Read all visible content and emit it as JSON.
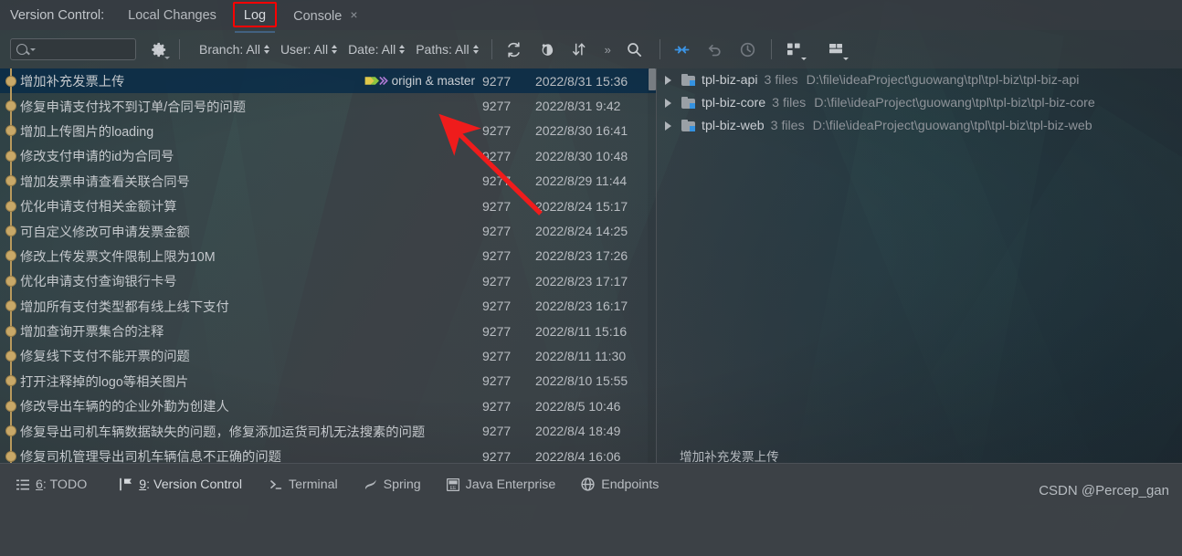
{
  "window": {
    "tool_window_label": "Version Control:",
    "tabs": [
      {
        "label": "Local Changes",
        "selected": false,
        "closable": false
      },
      {
        "label": "Log",
        "selected": true,
        "closable": false
      },
      {
        "label": "Console",
        "selected": false,
        "closable": true,
        "close_glyph": "×"
      }
    ]
  },
  "toolbar": {
    "search_placeholder": "",
    "search_value": "",
    "search_icon": "search-icon",
    "settings_icon": "gear-icon",
    "filters": [
      {
        "name": "branch",
        "label": "Branch: All"
      },
      {
        "name": "user",
        "label": "User: All"
      },
      {
        "name": "date",
        "label": "Date: All"
      },
      {
        "name": "paths",
        "label": "Paths: All"
      }
    ],
    "actions": [
      {
        "name": "refresh-icon",
        "glyph": "↻",
        "enabled": true
      },
      {
        "name": "highlight-icon",
        "glyph": "◕",
        "enabled": true
      },
      {
        "name": "sort-icon",
        "glyph": "⇅",
        "enabled": true
      },
      {
        "name": "overflow-chevrons",
        "glyph": "»",
        "enabled": true
      },
      {
        "name": "search-icon",
        "glyph": "⚲",
        "enabled": true
      }
    ],
    "right_actions": [
      {
        "name": "collapse-icon",
        "glyph": "→←",
        "enabled": true,
        "color": "#3592e0"
      },
      {
        "name": "revert-icon",
        "glyph": "↶",
        "enabled": false
      },
      {
        "name": "history-icon",
        "glyph": "◴",
        "enabled": false
      },
      {
        "name": "group-by-icon",
        "glyph": "☰",
        "enabled": true
      },
      {
        "name": "layout-icon",
        "glyph": "☷",
        "enabled": true
      }
    ]
  },
  "commit_list": {
    "columns": [
      "subject",
      "refs",
      "hash",
      "date"
    ],
    "rows": [
      {
        "subject": "增加补充发票上传",
        "refs": "origin & master",
        "hash": "9277",
        "date": "2022/8/31 15:36",
        "selected": true
      },
      {
        "subject": "修复申请支付找不到订单/合同号的问题",
        "refs": "",
        "hash": "9277",
        "date": "2022/8/31 9:42",
        "selected": false
      },
      {
        "subject": "增加上传图片的loading",
        "refs": "",
        "hash": "9277",
        "date": "2022/8/30 16:41",
        "selected": false
      },
      {
        "subject": "修改支付申请的id为合同号",
        "refs": "",
        "hash": "9277",
        "date": "2022/8/30 10:48",
        "selected": false
      },
      {
        "subject": "增加发票申请查看关联合同号",
        "refs": "",
        "hash": "9277",
        "date": "2022/8/29 11:44",
        "selected": false
      },
      {
        "subject": "优化申请支付相关金额计算",
        "refs": "",
        "hash": "9277",
        "date": "2022/8/24 15:17",
        "selected": false
      },
      {
        "subject": "可自定义修改可申请发票金额",
        "refs": "",
        "hash": "9277",
        "date": "2022/8/24 14:25",
        "selected": false
      },
      {
        "subject": "修改上传发票文件限制上限为10M",
        "refs": "",
        "hash": "9277",
        "date": "2022/8/23 17:26",
        "selected": false
      },
      {
        "subject": "优化申请支付查询银行卡号",
        "refs": "",
        "hash": "9277",
        "date": "2022/8/23 17:17",
        "selected": false
      },
      {
        "subject": "增加所有支付类型都有线上线下支付",
        "refs": "",
        "hash": "9277",
        "date": "2022/8/23 16:17",
        "selected": false
      },
      {
        "subject": "增加查询开票集合的注释",
        "refs": "",
        "hash": "9277",
        "date": "2022/8/11 15:16",
        "selected": false
      },
      {
        "subject": "修复线下支付不能开票的问题",
        "refs": "",
        "hash": "9277",
        "date": "2022/8/11 11:30",
        "selected": false
      },
      {
        "subject": "打开注释掉的logo等相关图片",
        "refs": "",
        "hash": "9277",
        "date": "2022/8/10 15:55",
        "selected": false
      },
      {
        "subject": "修改导出车辆的的企业外勤为创建人",
        "refs": "",
        "hash": "9277",
        "date": "2022/8/5 10:46",
        "selected": false
      },
      {
        "subject": "修复导出司机车辆数据缺失的问题，修复添加运货司机无法搜素的问题",
        "refs": "",
        "hash": "9277",
        "date": "2022/8/4 18:49",
        "selected": false
      },
      {
        "subject": "修复司机管理导出司机车辆信息不正确的问题",
        "refs": "",
        "hash": "9277",
        "date": "2022/8/4 16:06",
        "selected": false
      }
    ]
  },
  "details_panel": {
    "items": [
      {
        "name": "tpl-biz-api",
        "count": "3 files",
        "path": "D:\\file\\ideaProject\\guowang\\tpl\\tpl-biz\\tpl-biz-api"
      },
      {
        "name": "tpl-biz-core",
        "count": "3 files",
        "path": "D:\\file\\ideaProject\\guowang\\tpl\\tpl-biz\\tpl-biz-core"
      },
      {
        "name": "tpl-biz-web",
        "count": "3 files",
        "path": "D:\\file\\ideaProject\\guowang\\tpl\\tpl-biz\\tpl-biz-web"
      }
    ],
    "commit_message": "增加补充发票上传"
  },
  "statusbar": {
    "items": [
      {
        "name": "todo",
        "number": "6",
        "label": ": TODO",
        "icon": "list-icon",
        "active": false
      },
      {
        "name": "version-control",
        "number": "9",
        "label": ": Version Control",
        "icon": "branch-icon",
        "active": true
      },
      {
        "name": "terminal",
        "number": "",
        "label": "Terminal",
        "icon": "terminal-icon",
        "active": false
      },
      {
        "name": "spring",
        "number": "",
        "label": "Spring",
        "icon": "leaf-icon",
        "active": false
      },
      {
        "name": "java-enterprise",
        "number": "",
        "label": "Java Enterprise",
        "icon": "ee-icon",
        "active": false
      },
      {
        "name": "endpoints",
        "number": "",
        "label": "Endpoints",
        "icon": "globe-icon",
        "active": false
      }
    ],
    "watermark": "CSDN @Percep_gan"
  },
  "annotations": {
    "highlight_color": "#fe0000",
    "arrow_color": "#ef1c1c",
    "highlighted": [
      "Log",
      "9: Version Control"
    ]
  }
}
